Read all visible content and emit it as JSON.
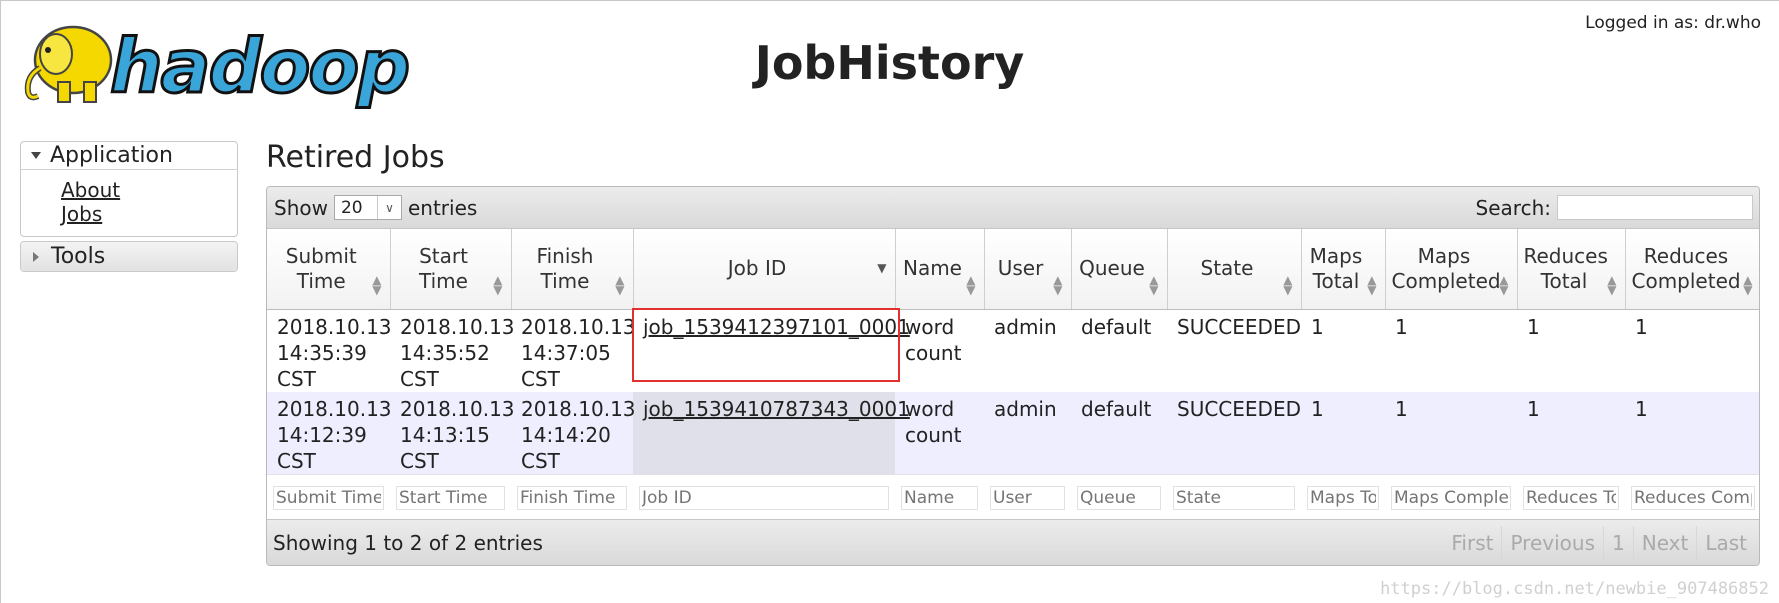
{
  "header": {
    "logo_text": "hadoop",
    "title": "JobHistory",
    "logged_in": "Logged in as: dr.who"
  },
  "sidebar": {
    "sections": [
      {
        "label": "Application",
        "expanded": true,
        "links": [
          "About",
          "Jobs"
        ]
      },
      {
        "label": "Tools",
        "expanded": false,
        "links": []
      }
    ]
  },
  "main": {
    "title": "Retired Jobs",
    "show_label": "Show",
    "entries_value": "20",
    "entries_label": "entries",
    "search_label": "Search:",
    "columns": [
      "Submit Time",
      "Start Time",
      "Finish Time",
      "Job ID",
      "Name",
      "User",
      "Queue",
      "State",
      "Maps Total",
      "Maps Completed",
      "Reduces Total",
      "Reduces Completed"
    ],
    "sorted_column": "Job ID",
    "rows": [
      {
        "submit": [
          "2018.10.13",
          "14:35:39",
          "CST"
        ],
        "start": [
          "2018.10.13",
          "14:35:52",
          "CST"
        ],
        "finish": [
          "2018.10.13",
          "14:37:05",
          "CST"
        ],
        "job_id": "job_1539412397101_0001",
        "name": [
          "word",
          "count"
        ],
        "user": "admin",
        "queue": "default",
        "state": "SUCCEEDED",
        "maps_total": "1",
        "maps_completed": "1",
        "reduces_total": "1",
        "reduces_completed": "1"
      },
      {
        "submit": [
          "2018.10.13",
          "14:12:39",
          "CST"
        ],
        "start": [
          "2018.10.13",
          "14:13:15",
          "CST"
        ],
        "finish": [
          "2018.10.13",
          "14:14:20",
          "CST"
        ],
        "job_id": "job_1539410787343_0001",
        "name": [
          "word",
          "count"
        ],
        "user": "admin",
        "queue": "default",
        "state": "SUCCEEDED",
        "maps_total": "1",
        "maps_completed": "1",
        "reduces_total": "1",
        "reduces_completed": "1"
      }
    ],
    "filter_placeholders": [
      "Submit Time",
      "Start Time",
      "Finish Time",
      "Job ID",
      "Name",
      "User",
      "Queue",
      "State",
      "Maps To",
      "Maps Complet",
      "Reduces To",
      "Reduces Comp"
    ],
    "showing_text": "Showing 1 to 2 of 2 entries",
    "pager": [
      "First",
      "Previous",
      "1",
      "Next",
      "Last"
    ]
  },
  "watermark": "https://blog.csdn.net/newbie_907486852",
  "colors": {
    "highlight": "#e03030",
    "row_even": "#eeeeff",
    "logo_yellow": "#f5d800",
    "logo_blue": "#3aa5d8"
  }
}
